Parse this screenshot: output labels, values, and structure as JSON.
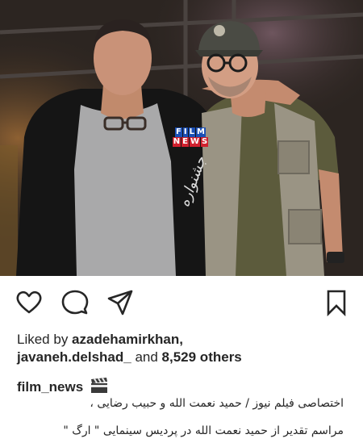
{
  "photo": {
    "watermark_top": [
      "F",
      "I",
      "L",
      "M"
    ],
    "watermark_bottom": [
      "N",
      "E",
      "W",
      "S"
    ],
    "watermark_script": "جشنواره"
  },
  "actions": {
    "icons": [
      "heart-icon",
      "comment-icon",
      "share-icon",
      "bookmark-icon"
    ]
  },
  "likes": {
    "prefix": "Liked by ",
    "user1": "azadehamirkhan",
    "sep": ",",
    "user2": "javaneh.delshad_",
    "and": " and ",
    "count": "8,529 others"
  },
  "caption": {
    "username": "film_news",
    "line1": "اختصاصی فیلم نیوز / حمید نعمت الله و حبیب رضایی ،",
    "line2": "مراسم تقدیر از حمید نعمت الله در پردیس سینمایی \" ارگ \""
  }
}
